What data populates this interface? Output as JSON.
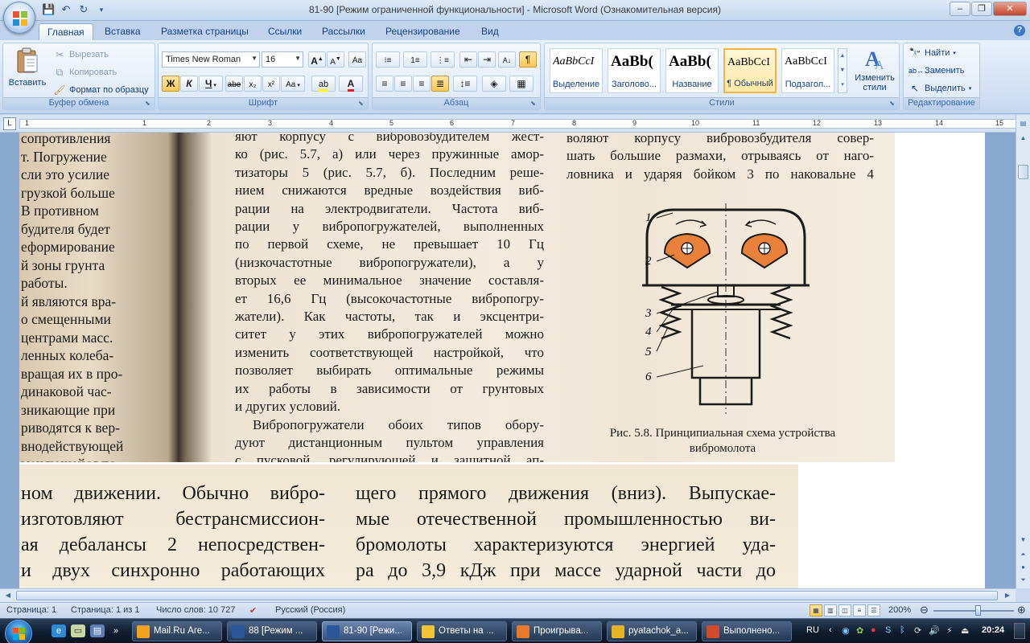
{
  "window": {
    "title": "81-90 [Режим ограниченной функциональности] - Microsoft Word (Ознакомительная версия)"
  },
  "tabs": [
    "Главная",
    "Вставка",
    "Разметка страницы",
    "Ссылки",
    "Рассылки",
    "Рецензирование",
    "Вид"
  ],
  "clipboard": {
    "paste": "Вставить",
    "cut": "Вырезать",
    "copy": "Копировать",
    "format_painter": "Формат по образцу",
    "label": "Буфер обмена"
  },
  "font": {
    "name": "Times New Roman",
    "size": "16",
    "label": "Шрифт",
    "bold": "Ж",
    "italic": "К",
    "underline": "Ч",
    "strike": "abe",
    "sub": "x₂",
    "sup": "x²",
    "case": "Aa",
    "grow": "A",
    "shrink": "A"
  },
  "paragraph": {
    "label": "Абзац"
  },
  "styles": {
    "label": "Стили",
    "items": [
      {
        "sample": "AaBbCcI",
        "name": "Выделение"
      },
      {
        "sample": "AaBb(",
        "name": "Заголово..."
      },
      {
        "sample": "AaBb(",
        "name": "Название"
      },
      {
        "sample": "AaBbCcI",
        "name": "¶ Обычный"
      },
      {
        "sample": "AaBbCcI",
        "name": "Подзагол..."
      }
    ],
    "change": "Изменить стили"
  },
  "editing": {
    "label": "Редактирование",
    "find": "Найти",
    "replace": "Заменить",
    "select": "Выделить"
  },
  "ruler": {
    "numbers": [
      "1",
      "1",
      "2",
      "3",
      "4",
      "5",
      "6",
      "7",
      "8",
      "9",
      "10",
      "11",
      "12",
      "13",
      "14",
      "15"
    ]
  },
  "doc": {
    "col_a": [
      "сопротивления",
      "т.  Погружение",
      "сли  это  усилие",
      "грузкой  больше",
      "В  противном",
      "будителя  будет",
      "еформирование",
      "й  зоны  грунта",
      "работы.",
      "й являются вра-",
      "о  смещенными",
      "центрами масс.",
      "ленных колеба-",
      "вращая их в про-",
      "динаковой час-",
      "зникающие  при",
      "риводятся к вер-",
      "внодействующей",
      "меняющейся  по"
    ],
    "col_b": [
      "яют корпусу с вибровозбудителем жест-",
      "ко (рис. 5.7, а) или через пружинные амор-",
      "тизаторы 5 (рис. 5.7, б). Последним реше-",
      "нием снижаются вредные воздействия виб-",
      "рации на электродвигатели. Частота виб-",
      "рации у вибропогружателей, выполненных",
      "по  первой  схеме,  не  превышает  10  Гц",
      "(низкочастотные вибропогружатели), а у",
      "вторых ее минимальное значение составля-",
      "ет 16,6 Гц (высокочастотные вибропогру-",
      "жатели). Как частоты, так и эксцентри-",
      "ситет у этих вибропогружателей можно",
      "изменить соответствующей настройкой, что",
      "позволяет выбирать оптимальные режимы",
      "их  работы  в  зависимости  от  грунтовых",
      "и других условий.",
      "Вибропогружатели обоих типов обору-",
      "дуют дистанционным пультом управления",
      "с пусковой, регулирующей и защитной ап-"
    ],
    "col_c": [
      "воляют корпусу вибровозбудителя совер-",
      "шать большие размахи, отрываясь от наго-",
      "ловника и ударяя бойком 3 по наковальне 4"
    ],
    "figure_labels": [
      "1",
      "2",
      "3",
      "4",
      "5",
      "6"
    ],
    "caption_1": "Рис.  5.8.  Принципиальная  схема  устройства",
    "caption_2": "вибромолота",
    "lower_left": [
      "ном  движении.  Обычно  вибро-",
      "изготовляют   бестрансмиссион-",
      "ая дебалансы 2 непосредствен-",
      "и двух синхронно работающих"
    ],
    "lower_right": [
      "щего прямого движения (вниз). Выпускае-",
      "мые  отечественной  промышленностью  ви-",
      "бромолоты характеризуются энергией уда-",
      "ра до 3,9 кДж при массе ударной части до"
    ]
  },
  "status": {
    "page": "Страница: 1",
    "pages": "Страница: 1 из 1",
    "words": "Число слов: 10 727",
    "language": "Русский (Россия)",
    "zoom": "200%"
  },
  "taskbar": {
    "tasks": [
      "Mail.Ru Аге...",
      "88 [Режим ...",
      "81-90 [Режи...",
      "Ответы на ...",
      "Проигрыва...",
      "pyatachok_a...",
      "Выполнено..."
    ],
    "lang": "RU",
    "time": "20:24"
  },
  "colors": {
    "accent": "#15428b",
    "figure_orange": "#e9813a"
  }
}
